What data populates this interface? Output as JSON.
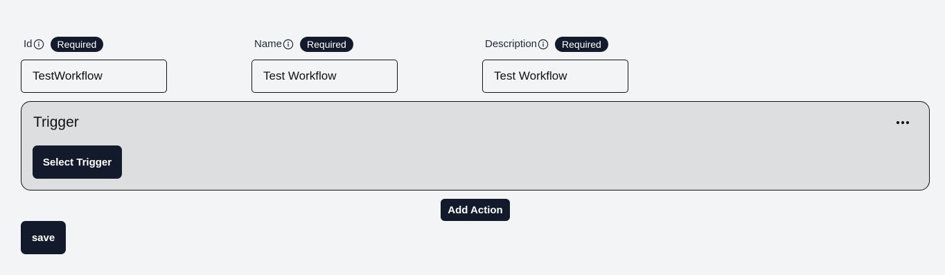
{
  "fields": [
    {
      "label": "Id",
      "badge": "Required",
      "value": "TestWorkflow"
    },
    {
      "label": "Name",
      "badge": "Required",
      "value": "Test Workflow"
    },
    {
      "label": "Description",
      "badge": "Required",
      "value": "Test Workflow"
    }
  ],
  "trigger": {
    "title": "Trigger",
    "select_label": "Select Trigger",
    "menu_icon": "more-horizontal-icon"
  },
  "actions": {
    "add_action_label": "Add Action",
    "save_label": "save"
  },
  "colors": {
    "background": "#f3f4f6",
    "card_background": "#dddee0",
    "dark_button": "#131a2c",
    "button_text": "#ffffff",
    "border": "#111111"
  }
}
